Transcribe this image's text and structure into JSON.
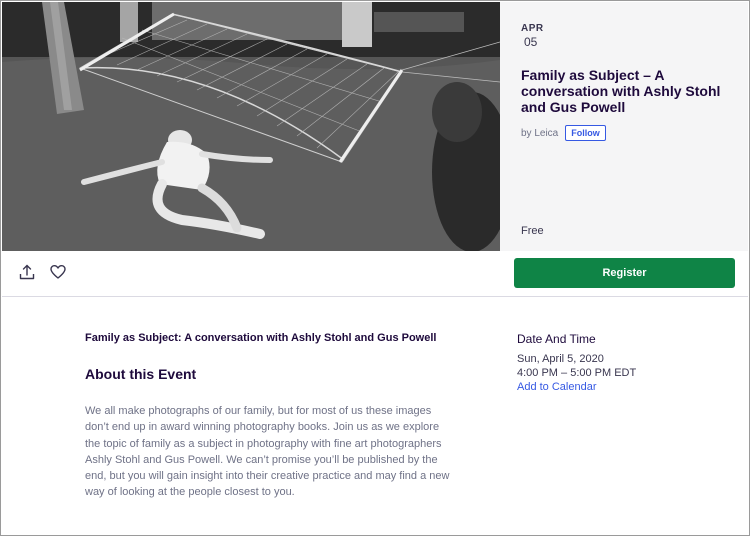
{
  "event": {
    "month": "APR",
    "day": "05",
    "title": "Family as Subject – A conversation with Ashly Stohl and Gus Powell",
    "organizer_text": "by Leica",
    "follow_label": "Follow",
    "price": "Free"
  },
  "actions": {
    "share_icon": "share-icon",
    "like_icon": "heart-icon",
    "register_label": "Register"
  },
  "details": {
    "subheading": "Family as Subject: A conversation with Ashly Stohl and Gus Powell",
    "about_title": "About this Event",
    "about_body": "We all make photographs of our family, but for most of us these images don’t end up in award winning photography books. Join us as we explore the topic of family as a subject in photography with fine art photographers Ashly Stohl and Gus Powell. We can’t promise you’ll be published by the end, but you will gain insight into their creative practice and may find a new way of looking at the people closest to you."
  },
  "date_time": {
    "heading": "Date And Time",
    "date": "Sun, April 5, 2020",
    "time": "4:00 PM – 5:00 PM EDT",
    "calendar_link": "Add to Calendar"
  },
  "colors": {
    "register": "#0f8446",
    "link": "#3659e3",
    "title": "#1e0a3c"
  }
}
